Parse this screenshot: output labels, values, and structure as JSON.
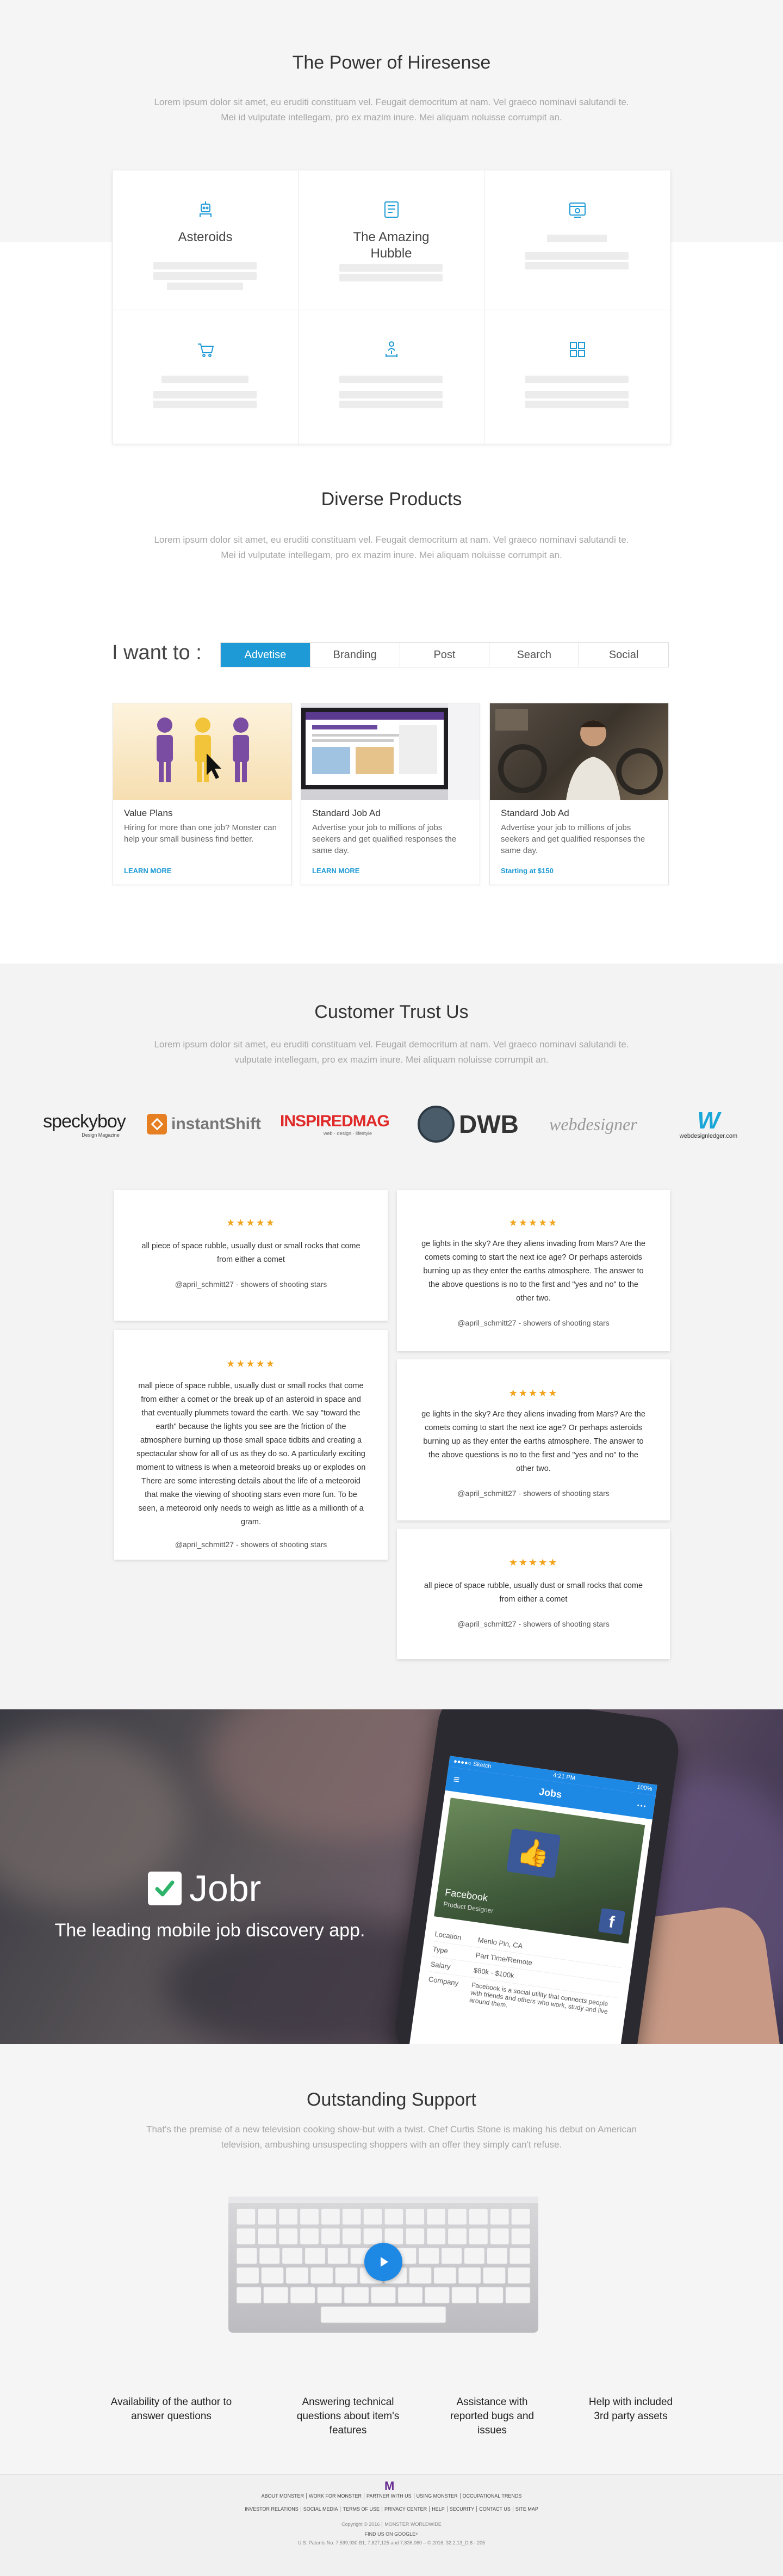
{
  "power": {
    "title": "The Power of Hiresense",
    "subtitle_line1": "Lorem ipsum dolor sit amet, eu eruditi constituam vel. Feugait democritum at nam. Vel graeco nominavi salutandi te.",
    "subtitle_line2": "Mei id vulputate intellegam, pro ex mazim inure. Mei aliquam noluisse corrumpit an.",
    "features": [
      {
        "label": "Asteroids",
        "icon": "robot-icon"
      },
      {
        "label": "The Amazing Hubble",
        "icon": "document-icon"
      },
      {
        "label": "",
        "icon": "browser-settings-icon"
      },
      {
        "label": "",
        "icon": "cart-icon"
      },
      {
        "label": "",
        "icon": "person-tree-icon"
      },
      {
        "label": "",
        "icon": "grid-icon"
      }
    ]
  },
  "products": {
    "title": "Diverse Products",
    "subtitle_line1": "Lorem ipsum dolor sit amet, eu eruditi constituam vel. Feugait democritum at nam. Vel graeco nominavi salutandi te.",
    "subtitle_line2": "Mei id vulputate intellegam, pro ex mazim inure. Mei aliquam noluisse corrumpit an.",
    "want_label": "I want to :",
    "tabs": [
      "Advetise",
      "Branding",
      "Post",
      "Search",
      "Social"
    ],
    "active_tab": "Advetise",
    "cards": [
      {
        "title": "Value Plans",
        "desc": "Hiring for more than one job? Monster can help your small business find better.",
        "link": "LEARN MORE"
      },
      {
        "title": "Standard Job Ad",
        "desc": "Advertise your job to millions of jobs seekers and get qualified responses the same day.",
        "link": "LEARN MORE"
      },
      {
        "title": "Standard Job Ad",
        "desc": "Advertise your job to millions of jobs seekers and get qualified responses the same day.",
        "link": "Starting at $150"
      }
    ]
  },
  "trust": {
    "title": "Customer Trust Us",
    "subtitle_line1": "Lorem ipsum dolor sit amet, eu eruditi constituam vel. Feugait democritum at nam. Vel graeco nominavi salutandi te.",
    "subtitle_line2": "vulputate intellegam, pro ex mazim inure. Mei aliquam noluisse corrumpit an.",
    "logos": {
      "speckyboy": "speckyboy",
      "speckyboy_sub": "Design Magazine",
      "instantshift": "instantShift",
      "inspired": "INSPIREDMAG",
      "inspired_sub": "web · design · lifestyle",
      "dwb": "DWB",
      "webdesigner": "webdesigner",
      "wdl": "webdesignledger.com"
    },
    "stars": "★★★★★",
    "reviews": [
      {
        "text": "all piece of space rubble, usually dust or small rocks that come from either a comet",
        "author": "@april_schmitt27 - showers of shooting stars"
      },
      {
        "text": "ge lights in the sky? Are they aliens invading from Mars? Are the comets coming to start the next ice age? Or perhaps asteroids burning up as they enter the earths atmosphere. The answer to the above questions is no to the first and \"yes and no\" to the other two.",
        "author": "@april_schmitt27 - showers of shooting stars"
      },
      {
        "text": "mall piece of space rubble, usually dust or small rocks that come from either a comet or the break up of an asteroid in space and that eventually plummets toward the earth. We say \"toward the earth\" because the lights you see are the friction of the atmosphere burning up those small space tidbits and creating a spectacular show for all of us as they do so. A particularly exciting moment to witness is when a meteoroid breaks up or explodes on There are some interesting details about the life of a meteoroid that make the viewing of shooting stars even more fun. To be seen, a meteoroid only needs to weigh as little as a millionth of a gram.",
        "author": "@april_schmitt27 - showers of shooting stars"
      },
      {
        "text": "ge lights in the sky? Are they aliens invading from Mars? Are the comets coming to start the next ice age? Or perhaps asteroids burning up as they enter the earths atmosphere. The answer to the above questions is no to the first and \"yes and no\" to the other two.",
        "author": "@april_schmitt27 - showers of shooting stars"
      },
      {
        "text": "all piece of space rubble, usually dust or small rocks that come from either a comet",
        "author": "@april_schmitt27 - showers of shooting stars"
      }
    ]
  },
  "jobr": {
    "name": "Jobr",
    "tagline": "The leading mobile job discovery app.",
    "phone": {
      "carrier": "●●●●○ Sketch",
      "time": "4:21 PM",
      "battery": "100%",
      "header": "Jobs",
      "company_title": "Facebook",
      "company_sub": "Product Designer",
      "rows": [
        {
          "k": "Location",
          "v": "Menlo Pin, CA"
        },
        {
          "k": "Type",
          "v": "Part Time/Remote"
        },
        {
          "k": "Salary",
          "v": "$80k - $100k"
        },
        {
          "k": "Company",
          "v": "Facebook is a social utility that connects people with friends and others who work, study and live around them."
        }
      ]
    }
  },
  "support": {
    "title": "Outstanding Support",
    "subtitle_line1": "That's the premise of a new television cooking show-but with a twist. Chef Curtis Stone is making his debut on American",
    "subtitle_line2": "television, ambushing unsuspecting shoppers with an offer they simply can't refuse.",
    "features": [
      "Availability of the author to answer questions",
      "Answering technical questions about item's features",
      "Assistance with reported bugs and issues",
      "Help with included 3rd party assets"
    ]
  },
  "footer": {
    "logo": "M",
    "row1": [
      "ABOUT MONSTER",
      "WORK FOR MONSTER",
      "PARTNER WITH US",
      "USING MONSTER",
      "OCCUPATIONAL TRENDS"
    ],
    "row2": [
      "INVESTOR RELATIONS",
      "SOCIAL MEDIA",
      "TERMS OF USE",
      "PRIVACY CENTER",
      "HELP",
      "SECURITY",
      "CONTACT US",
      "SITE MAP"
    ],
    "copyright": "Copyright © 2016",
    "worldwide": "MONSTER WORLDWIDE",
    "google": "FIND US ON GOOGLE+",
    "patents": "U.S. Patents No. 7,599,930 B1; 7,827,125 and 7,836,060 – © 2016, 32.2.13_D.8 - 205"
  },
  "colors": {
    "accent": "#1e9ad6",
    "stars": "#f2a41c"
  }
}
